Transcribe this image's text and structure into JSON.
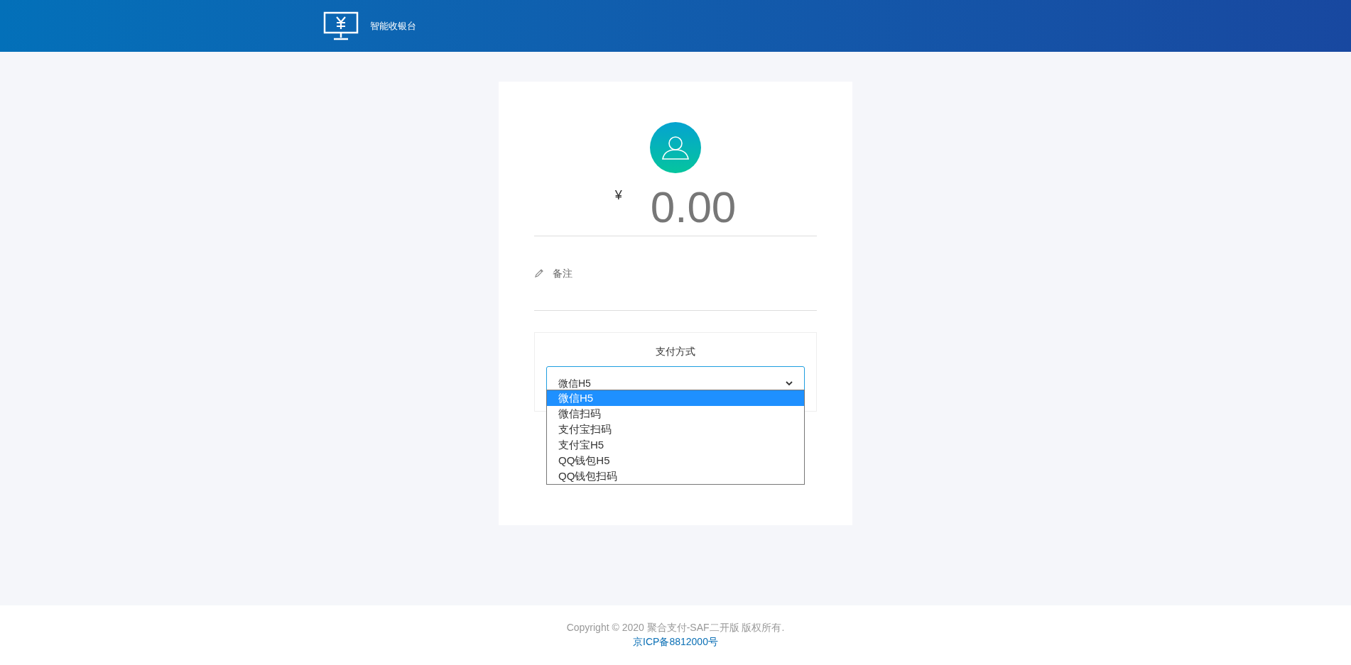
{
  "header": {
    "title": "智能收银台"
  },
  "amount": {
    "currency": "¥",
    "value": "0.00"
  },
  "note": {
    "label": "备注"
  },
  "payment": {
    "label": "支付方式",
    "value": "微信H5",
    "expanded": true,
    "options": [
      {
        "label": "微信H5",
        "selected": true
      },
      {
        "label": "微信扫码",
        "selected": false
      },
      {
        "label": "支付宝扫码",
        "selected": false
      },
      {
        "label": "支付宝H5",
        "selected": false
      },
      {
        "label": "QQ钱包H5",
        "selected": false
      },
      {
        "label": "QQ钱包扫码",
        "selected": false
      }
    ]
  },
  "footer": {
    "copyright": "Copyright © 2020 聚合支付-SAF二开版 版权所有.",
    "icp": "京ICP备8812000号"
  }
}
